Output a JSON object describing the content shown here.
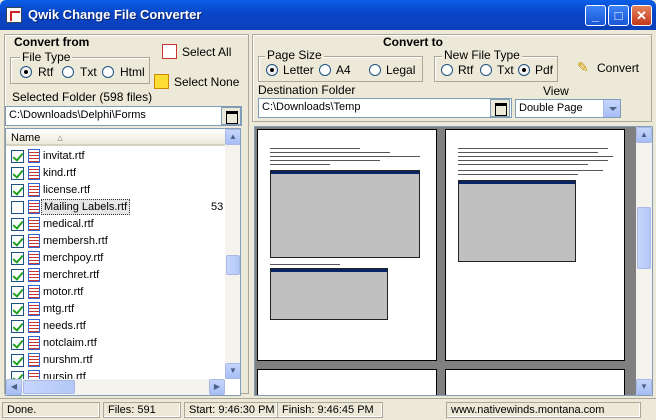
{
  "window": {
    "title": "Qwik Change File Converter",
    "min": "_",
    "max": "□",
    "close": "✕"
  },
  "convert_from": {
    "heading": "Convert from",
    "file_type_label": "File Type",
    "file_types": [
      "Rtf",
      "Txt",
      "Html"
    ],
    "selected_file_type": "Rtf",
    "select_all": "Select All",
    "select_none": "Select None",
    "selected_folder_label": "Selected Folder (598 files)",
    "selected_folder_value": "C:\\Downloads\\Delphi\\Forms",
    "list_header": "Name",
    "files": [
      {
        "name": "invitat.rtf",
        "checked": true
      },
      {
        "name": "kind.rtf",
        "checked": true
      },
      {
        "name": "license.rtf",
        "checked": true
      },
      {
        "name": "Mailing Labels.rtf",
        "checked": false,
        "selected": true,
        "extra": "53"
      },
      {
        "name": "medical.rtf",
        "checked": true
      },
      {
        "name": "membersh.rtf",
        "checked": true
      },
      {
        "name": "merchpoy.rtf",
        "checked": true
      },
      {
        "name": "merchret.rtf",
        "checked": true
      },
      {
        "name": "motor.rtf",
        "checked": true
      },
      {
        "name": "mtg.rtf",
        "checked": true
      },
      {
        "name": "needs.rtf",
        "checked": true
      },
      {
        "name": "notclaim.rtf",
        "checked": true
      },
      {
        "name": "nurshm.rtf",
        "checked": true
      },
      {
        "name": "nursin.rtf",
        "checked": true
      }
    ]
  },
  "convert_to": {
    "heading": "Convert to",
    "page_size_label": "Page Size",
    "page_sizes": [
      "Letter",
      "A4",
      "Legal"
    ],
    "selected_page_size": "Letter",
    "new_file_type_label": "New File Type",
    "new_file_types": [
      "Rtf",
      "Txt",
      "Pdf"
    ],
    "selected_new_file_type": "Pdf",
    "convert_button": "Convert",
    "destination_label": "Destination Folder",
    "destination_value": "C:\\Downloads\\Temp",
    "view_label": "View",
    "view_value": "Double Page"
  },
  "status": {
    "state": "Done.",
    "files": "Files: 591",
    "start": "Start: 9:46:30 PM",
    "finish": "Finish: 9:46:45 PM",
    "website": "www.nativewinds.montana.com"
  },
  "colors": {
    "titlebar": "#0a5fe8",
    "face": "#ece9d8",
    "preview_bg": "#808080"
  }
}
